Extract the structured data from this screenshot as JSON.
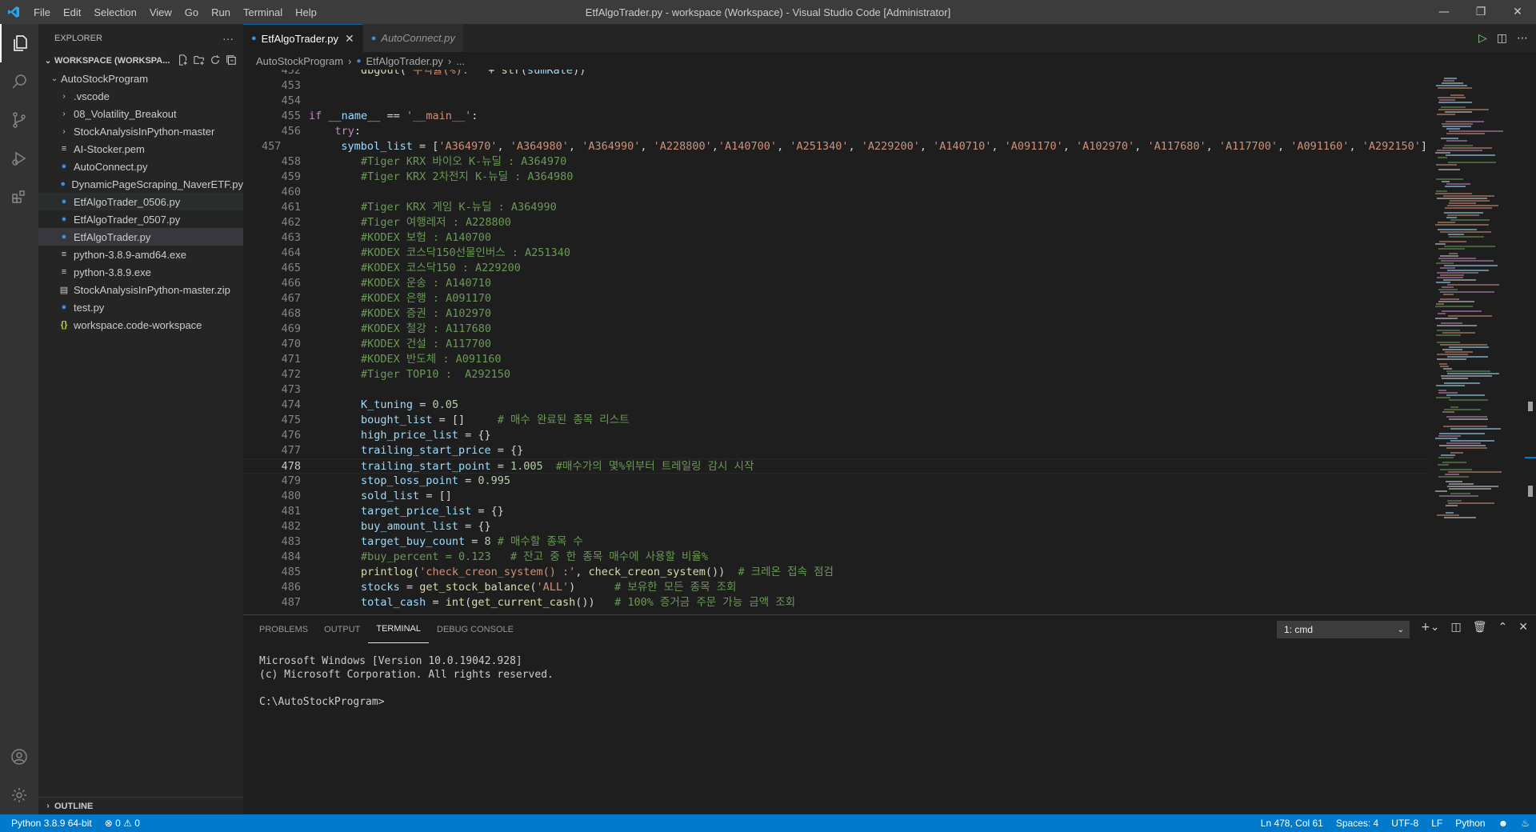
{
  "titlebar": {
    "menu": [
      "File",
      "Edit",
      "Selection",
      "View",
      "Go",
      "Run",
      "Terminal",
      "Help"
    ],
    "title": "EtfAlgoTrader.py - workspace (Workspace) - Visual Studio Code [Administrator]"
  },
  "sidebar": {
    "header": "EXPLORER",
    "more": "···",
    "workspace": "WORKSPACE (WORKSPA...",
    "root": "AutoStockProgram",
    "items": [
      {
        "label": ".vscode",
        "kind": "folder"
      },
      {
        "label": "08_Volatility_Breakout",
        "kind": "folder"
      },
      {
        "label": "StockAnalysisInPython-master",
        "kind": "folder"
      },
      {
        "label": "AI-Stocker.pem",
        "kind": "txt"
      },
      {
        "label": "AutoConnect.py",
        "kind": "py"
      },
      {
        "label": "DynamicPageScraping_NaverETF.py",
        "kind": "py"
      },
      {
        "label": "EtfAlgoTrader_0506.py",
        "kind": "py"
      },
      {
        "label": "EtfAlgoTrader_0507.py",
        "kind": "py"
      },
      {
        "label": "EtfAlgoTrader.py",
        "kind": "py"
      },
      {
        "label": "python-3.8.9-amd64.exe",
        "kind": "txt"
      },
      {
        "label": "python-3.8.9.exe",
        "kind": "txt"
      },
      {
        "label": "StockAnalysisInPython-master.zip",
        "kind": "zip"
      },
      {
        "label": "test.py",
        "kind": "py"
      },
      {
        "label": "workspace.code-workspace",
        "kind": "json"
      }
    ],
    "outline": "OUTLINE"
  },
  "tabs": [
    {
      "label": "EtfAlgoTrader.py",
      "active": true
    },
    {
      "label": "AutoConnect.py",
      "active": false
    }
  ],
  "breadcrumb": [
    "AutoStockProgram",
    "EtfAlgoTrader.py",
    "..."
  ],
  "code": {
    "current_line": 478,
    "lines": [
      {
        "n": "452",
        "t": "        dbgout('수익률(%): ' + str(sumRate))"
      },
      {
        "n": "453",
        "t": ""
      },
      {
        "n": "454",
        "t": ""
      },
      {
        "n": "455",
        "t": "if __name__ == '__main__':"
      },
      {
        "n": "456",
        "t": "    try:"
      },
      {
        "n": "457",
        "t": "        symbol_list = ['A364970', 'A364980', 'A364990', 'A228800','A140700', 'A251340', 'A229200', 'A140710', 'A091170', 'A102970', 'A117680', 'A117700', 'A091160', 'A292150']"
      },
      {
        "n": "458",
        "t": "        #Tiger KRX 바이오 K-뉴딜 : A364970"
      },
      {
        "n": "459",
        "t": "        #Tiger KRX 2차전지 K-뉴딜 : A364980"
      },
      {
        "n": "460",
        "t": ""
      },
      {
        "n": "461",
        "t": "        #Tiger KRX 게임 K-뉴딜 : A364990"
      },
      {
        "n": "462",
        "t": "        #Tiger 여행레저 : A228800"
      },
      {
        "n": "463",
        "t": "        #KODEX 보험 : A140700"
      },
      {
        "n": "464",
        "t": "        #KODEX 코스닥150선물인버스 : A251340"
      },
      {
        "n": "465",
        "t": "        #KODEX 코스닥150 : A229200"
      },
      {
        "n": "466",
        "t": "        #KODEX 운송 : A140710"
      },
      {
        "n": "467",
        "t": "        #KODEX 은행 : A091170"
      },
      {
        "n": "468",
        "t": "        #KODEX 증권 : A102970"
      },
      {
        "n": "469",
        "t": "        #KODEX 철강 : A117680"
      },
      {
        "n": "470",
        "t": "        #KODEX 건설 : A117700"
      },
      {
        "n": "471",
        "t": "        #KODEX 반도체 : A091160"
      },
      {
        "n": "472",
        "t": "        #Tiger TOP10 :  A292150"
      },
      {
        "n": "473",
        "t": ""
      },
      {
        "n": "474",
        "t": "        K_tuning = 0.05"
      },
      {
        "n": "475",
        "t": "        bought_list = []     # 매수 완료된 종목 리스트"
      },
      {
        "n": "476",
        "t": "        high_price_list = {}"
      },
      {
        "n": "477",
        "t": "        trailing_start_price = {}"
      },
      {
        "n": "478",
        "t": "        trailing_start_point = 1.005  #매수가의 몇%위부터 트레일링 감시 시작"
      },
      {
        "n": "479",
        "t": "        stop_loss_point = 0.995"
      },
      {
        "n": "480",
        "t": "        sold_list = []"
      },
      {
        "n": "481",
        "t": "        target_price_list = {}"
      },
      {
        "n": "482",
        "t": "        buy_amount_list = {}"
      },
      {
        "n": "483",
        "t": "        target_buy_count = 8 # 매수할 종목 수"
      },
      {
        "n": "484",
        "t": "        #buy_percent = 0.123   # 잔고 중 한 종목 매수에 사용할 비율%"
      },
      {
        "n": "485",
        "t": "        printlog('check_creon_system() :', check_creon_system())  # 크레온 접속 점검"
      },
      {
        "n": "486",
        "t": "        stocks = get_stock_balance('ALL')      # 보유한 모든 종목 조회"
      },
      {
        "n": "487",
        "t": "        total_cash = int(get_current_cash())   # 100% 증거금 주문 가능 금액 조회"
      }
    ]
  },
  "panel": {
    "tabs": [
      "PROBLEMS",
      "OUTPUT",
      "TERMINAL",
      "DEBUG CONSOLE"
    ],
    "active_tab": "TERMINAL",
    "terminal_select": "1: cmd",
    "terminal_lines": [
      "Microsoft Windows [Version 10.0.19042.928]",
      "(c) Microsoft Corporation. All rights reserved.",
      "",
      "C:\\AutoStockProgram>"
    ]
  },
  "statusbar": {
    "python": "Python 3.8.9 64-bit",
    "problems": "⊗ 0 ⚠ 0",
    "position": "Ln 478, Col 61",
    "spaces": "Spaces: 4",
    "encoding": "UTF-8",
    "eol": "LF",
    "language": "Python"
  },
  "colors": {
    "accent": "#007acc",
    "editor_bg": "#1e1e1e",
    "sidebar_bg": "#252526",
    "activitybar_bg": "#333333"
  }
}
